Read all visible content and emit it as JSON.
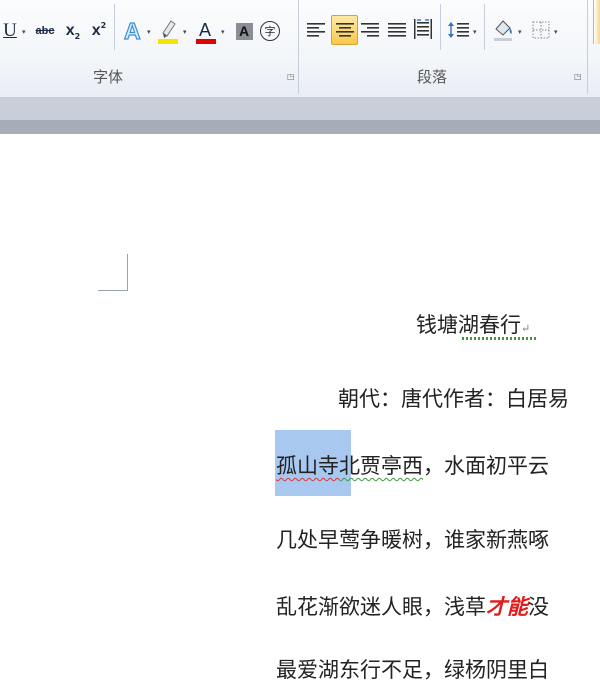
{
  "ribbon": {
    "font_group_label": "字体",
    "paragraph_group_label": "段落",
    "font_buttons": {
      "underline": "U",
      "strikethrough": "abc",
      "subscript": "x",
      "subscript_mark": "2",
      "superscript": "x",
      "superscript_mark": "2",
      "font_color": "A",
      "char_shading": "A",
      "enclose_char": "字"
    },
    "colors": {
      "highlight": "#f5e300",
      "font_color_bar": "#e00000",
      "active_button": "#f7c94a"
    }
  },
  "document": {
    "title": "钱塘湖春行",
    "meta": "朝代：唐代作者：白居易",
    "line1_selected": "孤山寺",
    "line1_rest_underlined": "北贾亭西",
    "line1_tail": "，水面初平云",
    "line2": "几处早莺争暖树，谁家新燕啄",
    "line3_start": "乱花渐欲迷人眼，浅草",
    "line3_emph": "才能",
    "line3_end": "没",
    "line4": "最爱湖东行不足，绿杨阴里白",
    "paragraph_mark": "↵"
  }
}
